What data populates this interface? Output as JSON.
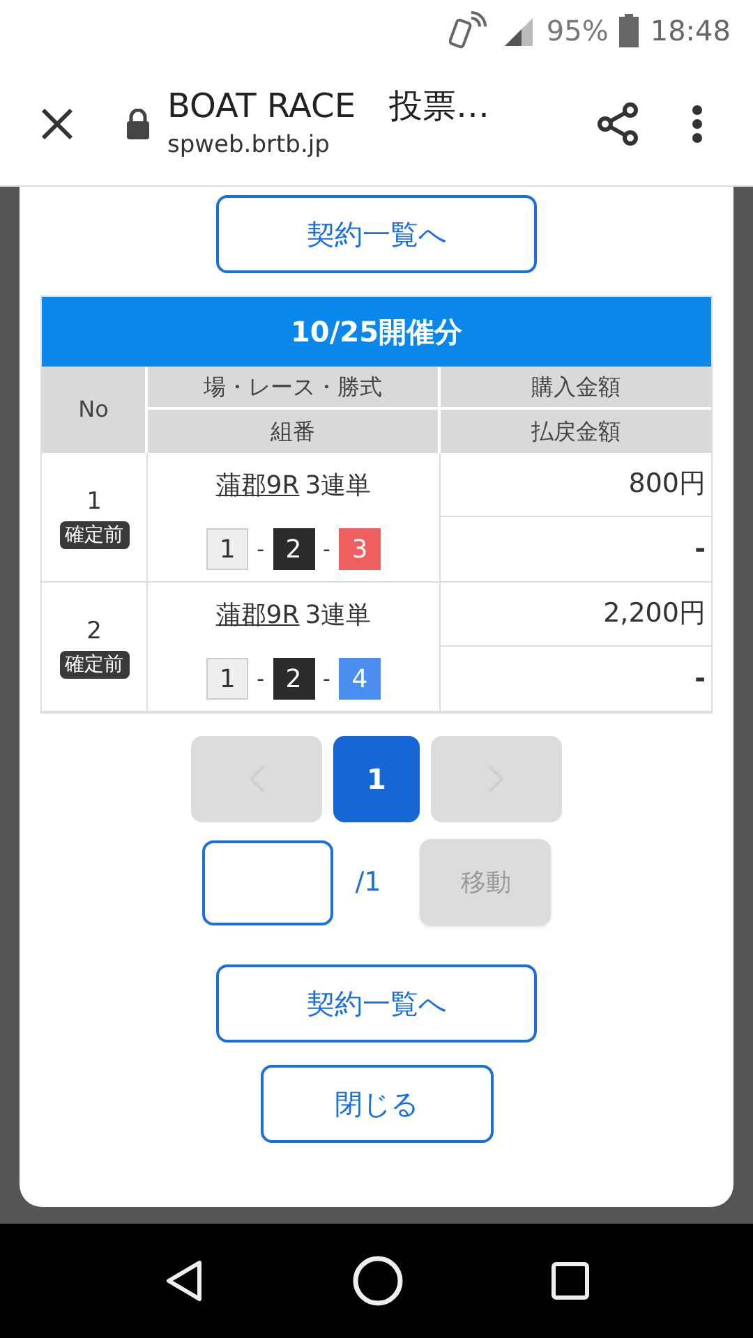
{
  "status_bar": {
    "battery": "95%",
    "time": "18:48"
  },
  "browser": {
    "title": "BOAT RACE　投票…",
    "url": "spweb.brtb.jp"
  },
  "top_button": "契約一覧へ",
  "table": {
    "title": "10/25開催分",
    "headers": {
      "no": "No",
      "race": "場・レース・勝式",
      "combo": "組番",
      "purchase": "購入金額",
      "payout": "払戻金額"
    },
    "rows": [
      {
        "no": "1",
        "status": "確定前",
        "race": "蒲郡9R",
        "bet_type": "3連単",
        "numbers": [
          {
            "text": "1",
            "color": "#eeeeee"
          },
          {
            "text": "2",
            "color": "#2b2b2b"
          },
          {
            "text": "3",
            "color": "#ef5f5f"
          }
        ],
        "separator": "-",
        "purchase": "800円",
        "payout": "-"
      },
      {
        "no": "2",
        "status": "確定前",
        "race": "蒲郡9R",
        "bet_type": "3連単",
        "numbers": [
          {
            "text": "1",
            "color": "#eeeeee"
          },
          {
            "text": "2",
            "color": "#2b2b2b"
          },
          {
            "text": "4",
            "color": "#4a8ef0"
          }
        ],
        "separator": "-",
        "purchase": "2,200円",
        "payout": "-"
      }
    ]
  },
  "pagination": {
    "pages": [
      {
        "label": "1",
        "selected": true
      }
    ],
    "prev_disabled": true,
    "next_disabled": true
  },
  "jump": {
    "total": "/1",
    "button": "移動",
    "disabled": true
  },
  "bottom_buttons": [
    "契約一覧へ",
    "閉じる"
  ]
}
